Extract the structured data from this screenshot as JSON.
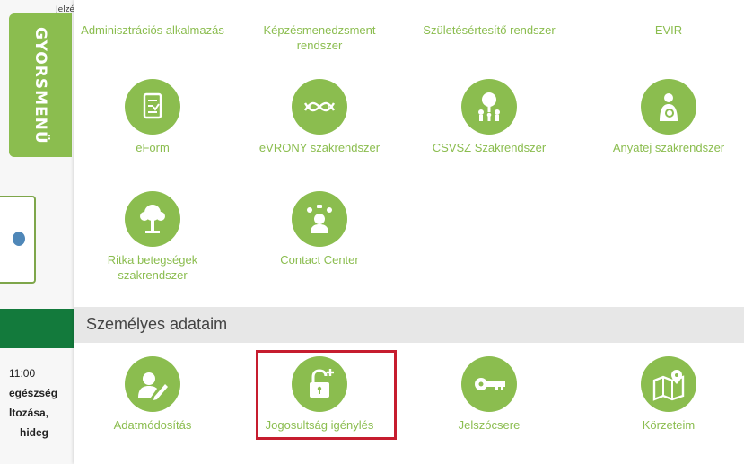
{
  "background": {
    "snippet": "Jelzé módosítás",
    "time": "11:00",
    "line1": "egészség",
    "line2": "ltozása,",
    "line3": "hideg"
  },
  "side_tab": {
    "label": "GYORSMENÜ"
  },
  "menu": {
    "top_items": [
      {
        "label": "Adminisztrációs alkalmazás"
      },
      {
        "label": "Képzésmenedzsment rendszer"
      },
      {
        "label": "Születésértesítő rendszer"
      },
      {
        "label": "EVIR"
      }
    ],
    "row2": [
      {
        "label": "eForm",
        "icon": "form-icon"
      },
      {
        "label": "eVRONY szakrendszer",
        "icon": "dna-icon"
      },
      {
        "label": "CSVSZ Szakrendszer",
        "icon": "family-tree-icon"
      },
      {
        "label": "Anyatej szakrendszer",
        "icon": "breastfeeding-icon"
      }
    ],
    "row3": [
      {
        "label": "Ritka betegségek szakrendszer",
        "icon": "tree-icon"
      },
      {
        "label": "Contact Center",
        "icon": "contact-icon"
      }
    ],
    "section_title": "Személyes adataim",
    "personal_items": [
      {
        "label": "Adatmódosítás",
        "icon": "user-edit-icon"
      },
      {
        "label": "Jogosultság igénylés",
        "icon": "unlock-plus-icon"
      },
      {
        "label": "Jelszócsere",
        "icon": "key-icon"
      },
      {
        "label": "Körzeteim",
        "icon": "map-pin-icon"
      }
    ]
  },
  "colors": {
    "accent": "#8bbd4f",
    "highlight": "#c61d2f",
    "section_bg": "#e7e7e7",
    "dark_green": "#137a3c"
  }
}
